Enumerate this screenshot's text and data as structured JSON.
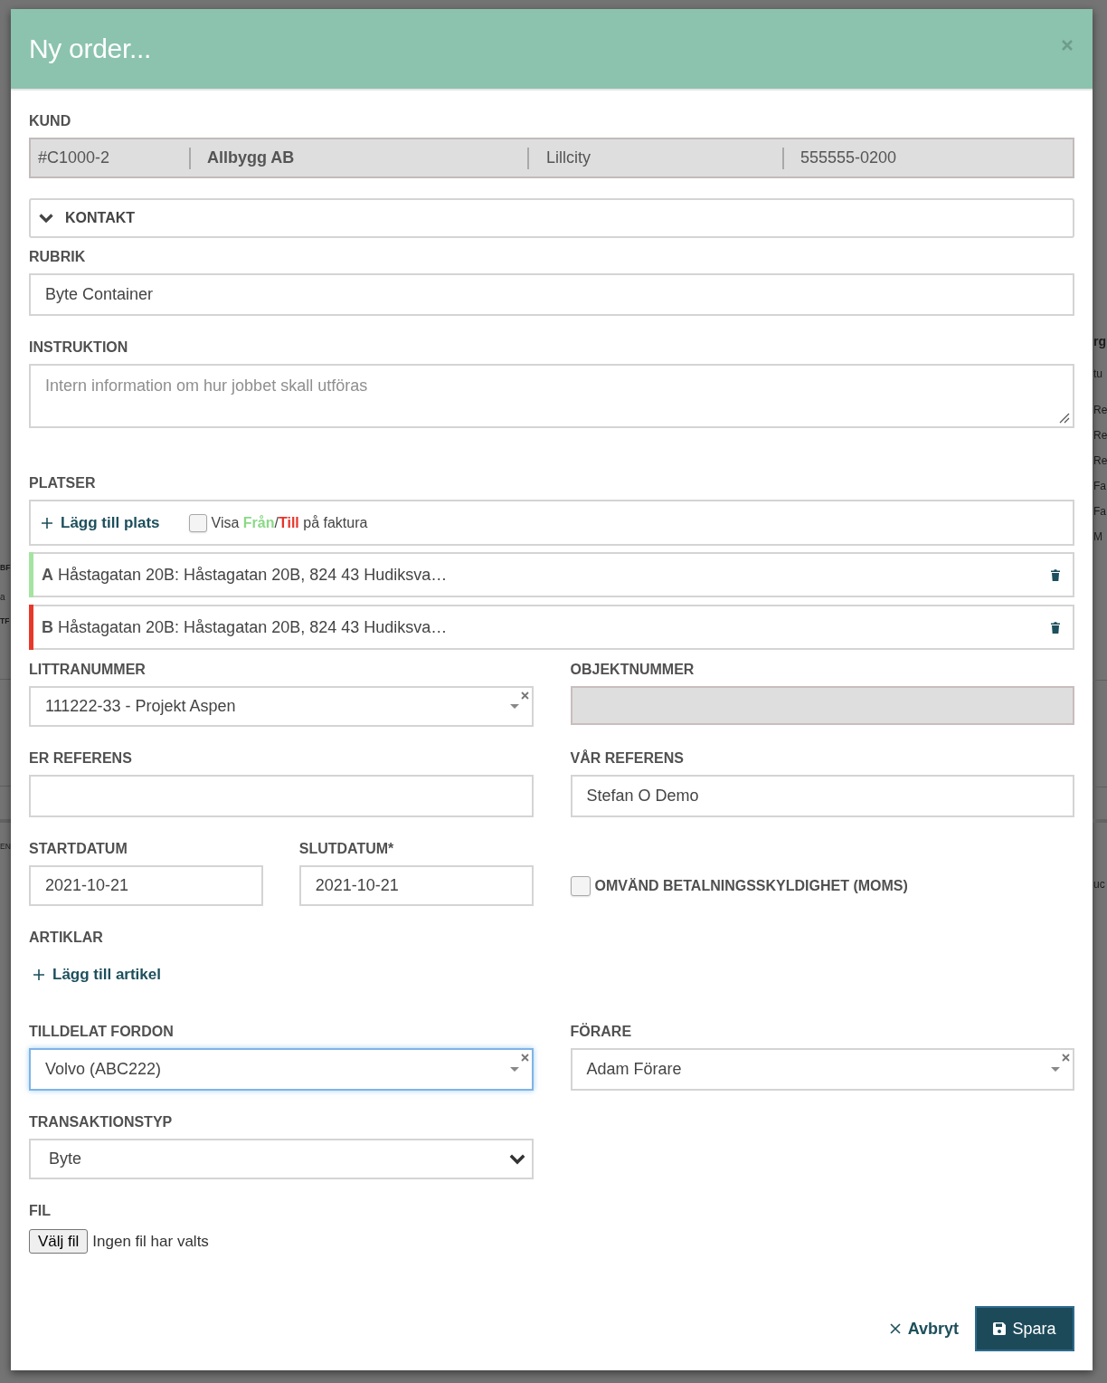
{
  "background_page": {
    "left_edge_texts": [
      "BF",
      "a",
      "TF",
      "EN"
    ],
    "right_edge_texts": [
      "rg",
      "tu",
      "Re",
      "Re",
      "Re",
      "Fa",
      "Fa",
      "M",
      "uc"
    ]
  },
  "modal": {
    "title": "Ny order..."
  },
  "customer": {
    "label": "KUND",
    "cells": [
      {
        "text": "#C1000-2",
        "bold": false
      },
      {
        "text": "Allbygg AB",
        "bold": true
      },
      {
        "text": "Lillcity",
        "bold": false
      },
      {
        "text": "555555-0200",
        "bold": false
      }
    ]
  },
  "contact": {
    "title": "KONTAKT",
    "expanded": false
  },
  "headline": {
    "label": "RUBRIK",
    "value": "Byte Container"
  },
  "instruction": {
    "label": "INSTRUKTION",
    "placeholder": "Intern information om hur jobbet skall utföras"
  },
  "places": {
    "label": "PLATSER",
    "add_link": "Lägg till plats",
    "invoice_option": {
      "text": "Visa **Från**/**Till** på faktura",
      "checked": false
    },
    "items": [
      {
        "letter": "A",
        "address": "Håstagatan 20B: Håstagatan 20B, 824 43 Hudiksva…",
        "color": "#a6e3a1"
      },
      {
        "letter": "B",
        "address": "Håstagatan 20B: Håstagatan 20B, 824 43 Hudiksva…",
        "color": "#e8382b"
      }
    ]
  },
  "order_fields": [
    {
      "label": "LITTRANUMMER",
      "kind": "select",
      "value": "111222-33 - Projekt Aspen",
      "disabled": false
    },
    {
      "label": "OBJEKTNUMMER",
      "kind": "input",
      "disabled": true
    },
    {
      "label": "ER REFERENS",
      "kind": "input",
      "disabled": false
    },
    {
      "label": "VÅR REFERENS",
      "kind": "input",
      "value": "Stefan O Demo",
      "disabled": false
    }
  ],
  "dates": [
    {
      "label": "STARTDATUM",
      "value": "2021-10-21"
    },
    {
      "label": "SLUTDATUM*",
      "value": "2021-10-21"
    }
  ],
  "reverse_vat": {
    "label": "OMVÄND BETALNINGSSKYLDIGHET (MOMS)",
    "checked": false
  },
  "articles": {
    "label": "ARTIKLAR",
    "add_link": "Lägg till artikel"
  },
  "assignment": [
    {
      "label": "TILLDELAT FORDON",
      "value": "Volvo (ABC222)",
      "focused": true
    },
    {
      "label": "FÖRARE",
      "value": "Adam Förare",
      "focused": false
    }
  ],
  "transaction_type": {
    "label": "TRANSAKTIONSTYP",
    "value": "Byte"
  },
  "file": {
    "label": "FIL",
    "button": "Välj fil",
    "status": "Ingen fil har valts"
  },
  "footer": {
    "cancel": "Avbryt",
    "save": "Spara"
  }
}
